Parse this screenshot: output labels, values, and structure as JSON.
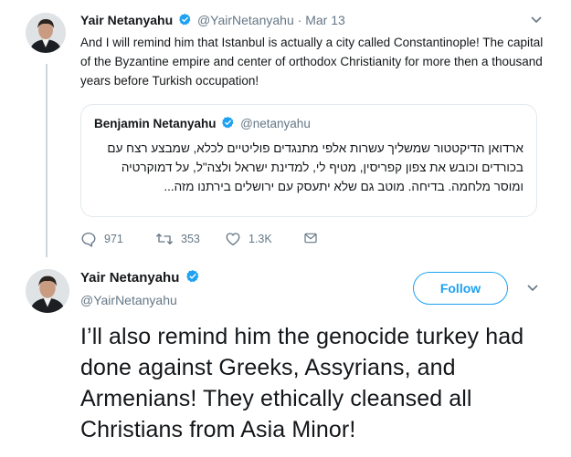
{
  "tweet1": {
    "name": "Yair Netanyahu",
    "handle": "@YairNetanyahu",
    "separator": "·",
    "date": "Mar 13",
    "text": "And I will remind him that Istanbul is actually a city called Constantinople! The capital of the Byzantine empire and center of orthodox Christianity for more then a thousand years before Turkish occupation!",
    "quote": {
      "name": "Benjamin Netanyahu",
      "handle": "@netanyahu",
      "text": "ארדואן הדיקטטור שמשליך עשרות אלפי מתנגדים פוליטיים לכלא, שמבצע רצח עם בכורדים וכובש את צפון קפריסין, מטיף לי, למדינת ישראל ולצה\"ל, על דמוקרטיה ומוסר מלחמה. בדיחה. מוטב גם שלא יתעסק עם ירושלים בירתנו מזה..."
    },
    "actions": {
      "replies": "971",
      "retweets": "353",
      "likes": "1.3K"
    }
  },
  "tweet2": {
    "name": "Yair Netanyahu",
    "handle": "@YairNetanyahu",
    "follow_label": "Follow",
    "text": "I’ll also remind him the genocide turkey had done against Greeks, Assyrians, and Armenians! They ethically cleansed all Christians from Asia Minor!"
  },
  "colors": {
    "accent": "#1da1f2",
    "secondary_text": "#657786",
    "border": "#e1e8ed"
  },
  "icons": [
    "verified-badge-icon",
    "chevron-down-icon",
    "reply-icon",
    "retweet-icon",
    "like-icon",
    "direct-message-icon"
  ]
}
